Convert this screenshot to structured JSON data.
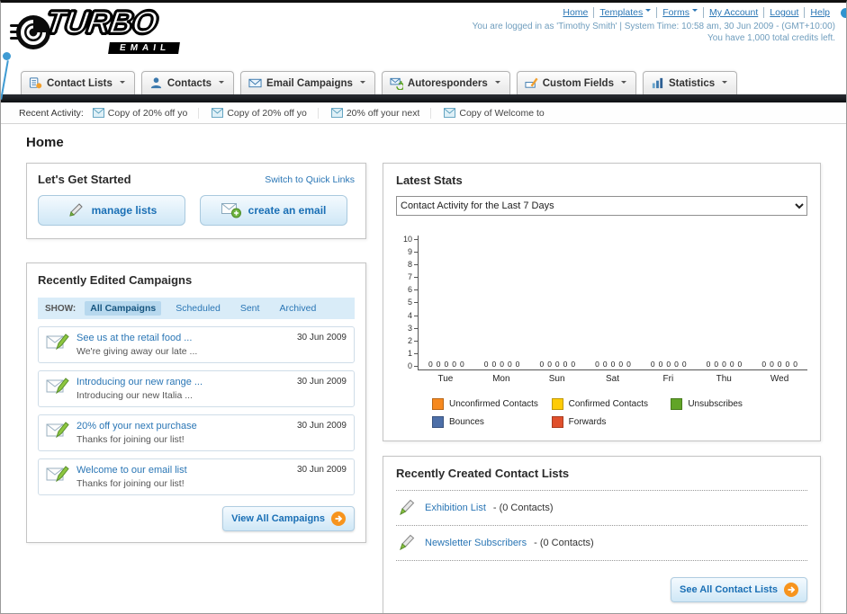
{
  "header": {
    "logo": {
      "primary": "TURBO",
      "secondary": "EMAIL"
    },
    "nav": [
      {
        "label": "Home",
        "dropdown": false
      },
      {
        "label": "Templates",
        "dropdown": true
      },
      {
        "label": "Forms",
        "dropdown": true
      },
      {
        "label": "My Account",
        "dropdown": false
      },
      {
        "label": "Logout",
        "dropdown": false
      },
      {
        "label": "Help",
        "dropdown": false
      }
    ],
    "session_info": "You are logged in as 'Timothy Smith' | System Time: 10:58 am, 30 Jun 2009 - (GMT+10:00)",
    "credits_info": "You have 1,000 total credits left."
  },
  "nav_tabs": [
    {
      "label": "Contact Lists"
    },
    {
      "label": "Contacts"
    },
    {
      "label": "Email Campaigns"
    },
    {
      "label": "Autoresponders"
    },
    {
      "label": "Custom Fields"
    },
    {
      "label": "Statistics"
    }
  ],
  "recent_activity": {
    "label": "Recent Activity:",
    "items": [
      "Copy of 20% off yo",
      "Copy of 20% off yo",
      "20% off your next",
      "Copy of Welcome to"
    ]
  },
  "page_title": "Home",
  "get_started": {
    "title": "Let's Get Started",
    "switch_link": "Switch to Quick Links",
    "manage_lists_button": "manage lists",
    "create_email_button": "create an email"
  },
  "campaigns": {
    "title": "Recently Edited Campaigns",
    "show_label": "SHOW:",
    "filters": [
      "All Campaigns",
      "Scheduled",
      "Sent",
      "Archived"
    ],
    "active_filter": "All Campaigns",
    "items": [
      {
        "title": "See us at the retail food ...",
        "subtitle": "We're giving away our late ...",
        "date": "30 Jun 2009"
      },
      {
        "title": "Introducing our new range ...",
        "subtitle": "Introducing our new Italia ...",
        "date": "30 Jun 2009"
      },
      {
        "title": "20% off your next purchase",
        "subtitle": "Thanks for joining our list!",
        "date": "30 Jun 2009"
      },
      {
        "title": "Welcome to our email list",
        "subtitle": "Thanks for joining our list!",
        "date": "30 Jun 2009"
      }
    ],
    "view_all_button": "View All Campaigns"
  },
  "stats": {
    "title": "Latest Stats",
    "selected_option": "Contact Activity for the Last 7 Days",
    "chart_data": {
      "type": "bar",
      "title": "Contact Activity for the Last 7 Days",
      "categories": [
        "Tue",
        "Mon",
        "Sun",
        "Sat",
        "Fri",
        "Thu",
        "Wed"
      ],
      "series": [
        {
          "name": "Unconfirmed Contacts",
          "color": "#f6891f",
          "values": [
            0,
            0,
            0,
            0,
            0,
            0,
            0
          ]
        },
        {
          "name": "Confirmed Contacts",
          "color": "#ffcb05",
          "values": [
            0,
            0,
            0,
            0,
            0,
            0,
            0
          ]
        },
        {
          "name": "Unsubscribes",
          "color": "#61a427",
          "values": [
            0,
            0,
            0,
            0,
            0,
            0,
            0
          ]
        },
        {
          "name": "Bounces",
          "color": "#4d6fa8",
          "values": [
            0,
            0,
            0,
            0,
            0,
            0,
            0
          ]
        },
        {
          "name": "Forwards",
          "color": "#e0502c",
          "values": [
            0,
            0,
            0,
            0,
            0,
            0,
            0
          ]
        }
      ],
      "y_ticks": [
        10,
        9,
        8,
        7,
        6,
        5,
        4,
        3,
        2,
        1,
        0
      ],
      "ylim": [
        0,
        10
      ],
      "grid": false,
      "legend_position": "bottom"
    }
  },
  "contact_lists": {
    "title": "Recently Created Contact Lists",
    "items": [
      {
        "name": "Exhibition List",
        "detail": "- (0 Contacts)"
      },
      {
        "name": "Newsletter Subscribers",
        "detail": "- (0 Contacts)"
      }
    ],
    "see_all_button": "See All Contact Lists"
  }
}
